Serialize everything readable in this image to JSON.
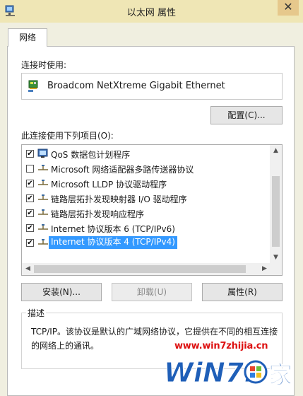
{
  "window": {
    "title": "以太网 属性",
    "close_glyph": "✕"
  },
  "tabs": [
    {
      "label": "网络"
    }
  ],
  "connect_using": {
    "label": "连接时使用:",
    "adapter_name": "Broadcom NetXtreme Gigabit Ethernet",
    "configure_label": "配置(C)..."
  },
  "items_section": {
    "label": "此连接使用下列项目(O):",
    "items": [
      {
        "label": "QoS 数据包计划程序",
        "checked": true,
        "icon": "qos-icon"
      },
      {
        "label": "Microsoft 网络适配器多路传送器协议",
        "checked": false,
        "icon": "protocol-icon"
      },
      {
        "label": "Microsoft LLDP 协议驱动程序",
        "checked": true,
        "icon": "protocol-icon"
      },
      {
        "label": "链路层拓扑发现映射器 I/O 驱动程序",
        "checked": true,
        "icon": "protocol-icon"
      },
      {
        "label": "链路层拓扑发现响应程序",
        "checked": true,
        "icon": "protocol-icon"
      },
      {
        "label": "Internet 协议版本 6 (TCP/IPv6)",
        "checked": true,
        "icon": "protocol-icon"
      },
      {
        "label": "Internet 协议版本 4 (TCP/IPv4)",
        "checked": true,
        "icon": "protocol-icon",
        "selected": true
      }
    ]
  },
  "buttons": {
    "install": "安装(N)...",
    "uninstall": "卸载(U)",
    "properties": "属性(R)"
  },
  "description": {
    "title": "描述",
    "text": "TCP/IP。该协议是默认的广域网络协议，它提供在不同的相互连接的网络上的通讯。"
  },
  "watermark": {
    "url": "www.win7zhijia.cn",
    "logo_text": "WiN7.",
    "logo_char": "家"
  },
  "colors": {
    "titlebar": "#efe6b5",
    "selection": "#3399ff",
    "watermark_red": "#dd1111",
    "watermark_blue": "#1f5fb8"
  }
}
